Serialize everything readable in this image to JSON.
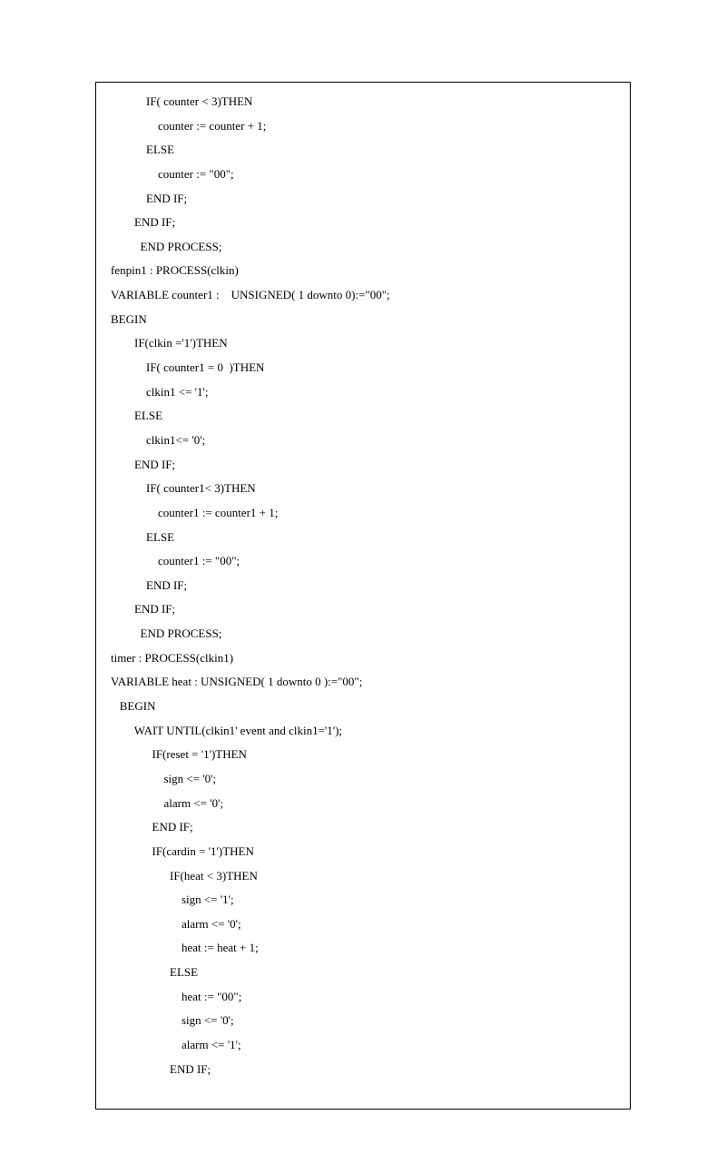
{
  "code_lines": [
    "            IF( counter < 3)THEN",
    "                counter := counter + 1;",
    "            ELSE",
    "                counter := \"00\";",
    "            END IF;",
    "        END IF;",
    "          END PROCESS;",
    "fenpin1 : PROCESS(clkin)",
    "VARIABLE counter1 :    UNSIGNED( 1 downto 0):=\"00\";",
    "BEGIN",
    "        IF(clkin ='1')THEN",
    "            IF( counter1 = 0  )THEN",
    "            clkin1 <= '1';",
    "        ELSE",
    "            clkin1<= '0';",
    "        END IF;",
    "",
    "            IF( counter1< 3)THEN",
    "                counter1 := counter1 + 1;",
    "            ELSE",
    "                counter1 := \"00\";",
    "            END IF;",
    "        END IF;",
    "          END PROCESS;",
    "",
    "timer : PROCESS(clkin1)",
    "VARIABLE heat : UNSIGNED( 1 downto 0 ):=\"00\";",
    "   BEGIN",
    "        WAIT UNTIL(clkin1' event and clkin1='1');",
    "              IF(reset = '1')THEN",
    "                  sign <= '0';",
    "                  alarm <= '0';",
    "              END IF;",
    "",
    "              IF(cardin = '1')THEN",
    "                    IF(heat < 3)THEN",
    "                        sign <= '1';",
    "                        alarm <= '0';",
    "                        heat := heat + 1;",
    "                    ELSE",
    "                        heat := \"00\";",
    "                        sign <= '0';",
    "                        alarm <= '1';",
    "                    END IF;"
  ]
}
